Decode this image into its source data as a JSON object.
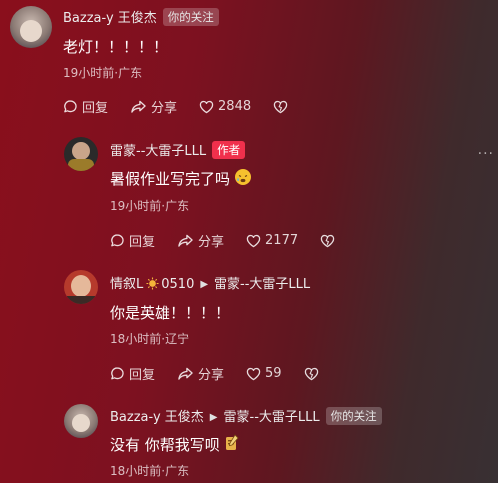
{
  "comments": [
    {
      "user": "Bazza-y 王俊杰",
      "badge": "你的关注",
      "text": "老灯！！！！！",
      "time": "19小时前",
      "location": "广东",
      "reply_label": "回复",
      "share_label": "分享",
      "likes": "2848"
    },
    {
      "user": "雷蒙--大雷子LLL",
      "badge": "作者",
      "text": "暑假作业写完了吗",
      "time": "19小时前",
      "location": "广东",
      "reply_label": "回复",
      "share_label": "分享",
      "likes": "2177"
    },
    {
      "user": "情叙L",
      "user_suffix": "0510",
      "reply_to": "雷蒙--大雷子LLL",
      "text": "你是英雄！！！！",
      "time": "18小时前",
      "location": "辽宁",
      "reply_label": "回复",
      "share_label": "分享",
      "likes": "59"
    },
    {
      "user": "Bazza-y 王俊杰",
      "reply_to": "雷蒙--大雷子LLL",
      "badge": "你的关注",
      "text": "没有 你帮我写呗",
      "time": "18小时前",
      "location": "广东"
    }
  ],
  "separator": "·",
  "more_label": "···",
  "colors": {
    "author_badge": "#f0304c",
    "background_start": "#8a0f1c",
    "background_end": "#383033"
  },
  "icons": {
    "reply": "reply-bubble-icon",
    "share": "share-arrow-icon",
    "like": "heart-icon",
    "dislike": "broken-heart-icon"
  }
}
